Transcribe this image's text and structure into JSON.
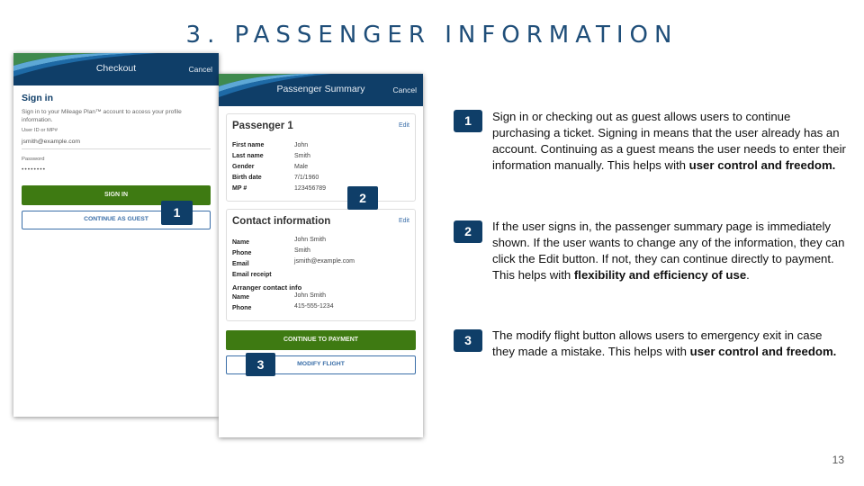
{
  "slide": {
    "title": "3. PASSENGER INFORMATION",
    "page_number": "13"
  },
  "checkout": {
    "header_title": "Checkout",
    "cancel_label": "Cancel",
    "heading": "Sign in",
    "description": "Sign in to your Mileage Plan™ account to access your profile information.",
    "user_id_label": "User ID or MP#",
    "user_id_value": "jsmith@example.com",
    "password_label": "Password",
    "password_value": "••••••••",
    "sign_in_button": "SIGN IN",
    "guest_button": "CONTINUE AS GUEST"
  },
  "summary": {
    "header_title": "Passenger Summary",
    "cancel_label": "Cancel",
    "passenger": {
      "title": "Passenger 1",
      "edit_label": "Edit",
      "fields": [
        {
          "label": "First name",
          "value": "John"
        },
        {
          "label": "Last name",
          "value": "Smith"
        },
        {
          "label": "Gender",
          "value": "Male"
        },
        {
          "label": "Birth date",
          "value": "7/1/1960"
        },
        {
          "label": "MP #",
          "value": "123456789"
        }
      ]
    },
    "contact": {
      "title": "Contact information",
      "edit_label": "Edit",
      "fields": [
        {
          "label": "Name",
          "value": "John Smith"
        },
        {
          "label": "Phone",
          "value": "Smith"
        },
        {
          "label": "Email",
          "value": "jsmith@example.com"
        },
        {
          "label": "Email receipt",
          "value": ""
        }
      ],
      "arranger_heading": "Arranger contact info",
      "arranger_fields": [
        {
          "label": "Name",
          "value": "John Smith"
        },
        {
          "label": "Phone",
          "value": "415-555-1234"
        }
      ]
    },
    "continue_button": "CONTINUE TO PAYMENT",
    "modify_button": "MODIFY FLIGHT"
  },
  "badges": {
    "one": "1",
    "two": "2",
    "three": "3"
  },
  "notes": [
    {
      "number": "1",
      "text": "Sign in or checking out as guest allows users to continue purchasing a ticket. Signing in means that the user already has an account. Continuing as a guest means the user needs to enter their information manually. This helps with ",
      "emphasis": "user control and freedom.",
      "tail": ""
    },
    {
      "number": "2",
      "text": "If the user signs in, the passenger summary page is immediately shown. If the user wants to change any of the information, they can click the Edit button. If not, they can continue directly to payment. This helps with ",
      "emphasis": "flexibility and efficiency of use",
      "tail": "."
    },
    {
      "number": "3",
      "text": "The modify flight button allows users to emergency exit in case they made a mistake. This helps with ",
      "emphasis": "user control and freedom.",
      "tail": ""
    }
  ],
  "colors": {
    "header_navy": "#0f3e68",
    "action_green": "#3e7a12",
    "link_blue": "#3a6ea8",
    "title_blue": "#1f4e79"
  }
}
